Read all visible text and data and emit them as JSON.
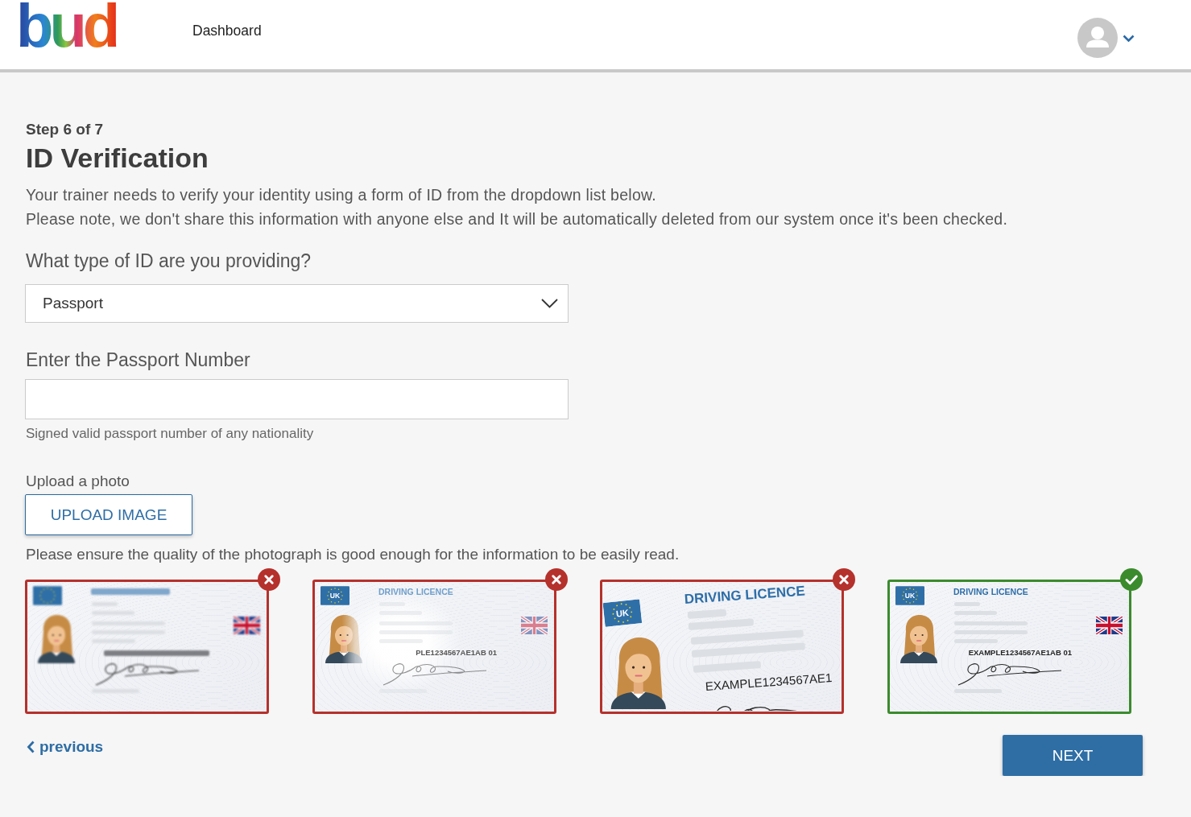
{
  "header": {
    "logo": "bud",
    "nav": [
      {
        "label": "Dashboard"
      }
    ]
  },
  "step": "Step 6 of 7",
  "title": "ID Verification",
  "intro": [
    "Your trainer needs to verify your identity using a form of ID from the dropdown list below.",
    "Please note, we don't share this information with anyone else and It will be automatically deleted from our system once it's been checked."
  ],
  "id_type": {
    "label": "What type of ID are you providing?",
    "value": "Passport"
  },
  "id_number": {
    "label": "Enter the Passport Number",
    "hint": "Signed valid passport number of any nationality"
  },
  "upload": {
    "label": "Upload a photo",
    "button": "UPLOAD IMAGE",
    "note": "Please ensure the quality of the photograph is good enough for the information to be easily read."
  },
  "examples": [
    {
      "kind": "blurry",
      "accepted": false
    },
    {
      "kind": "glare",
      "accepted": false,
      "badge": "UK",
      "title": "DRIVING LICENCE",
      "number": "PLE1234567AE1AB 01"
    },
    {
      "kind": "cropped",
      "accepted": false,
      "badge": "UK",
      "title": "DRIVING LICENCE",
      "number": "EXAMPLE1234567AE1"
    },
    {
      "kind": "good",
      "accepted": true,
      "badge": "UK",
      "title": "DRIVING LICENCE",
      "number": "EXAMPLE1234567AE1AB 01"
    }
  ],
  "footer": {
    "previous": "previous",
    "next": "NEXT"
  }
}
